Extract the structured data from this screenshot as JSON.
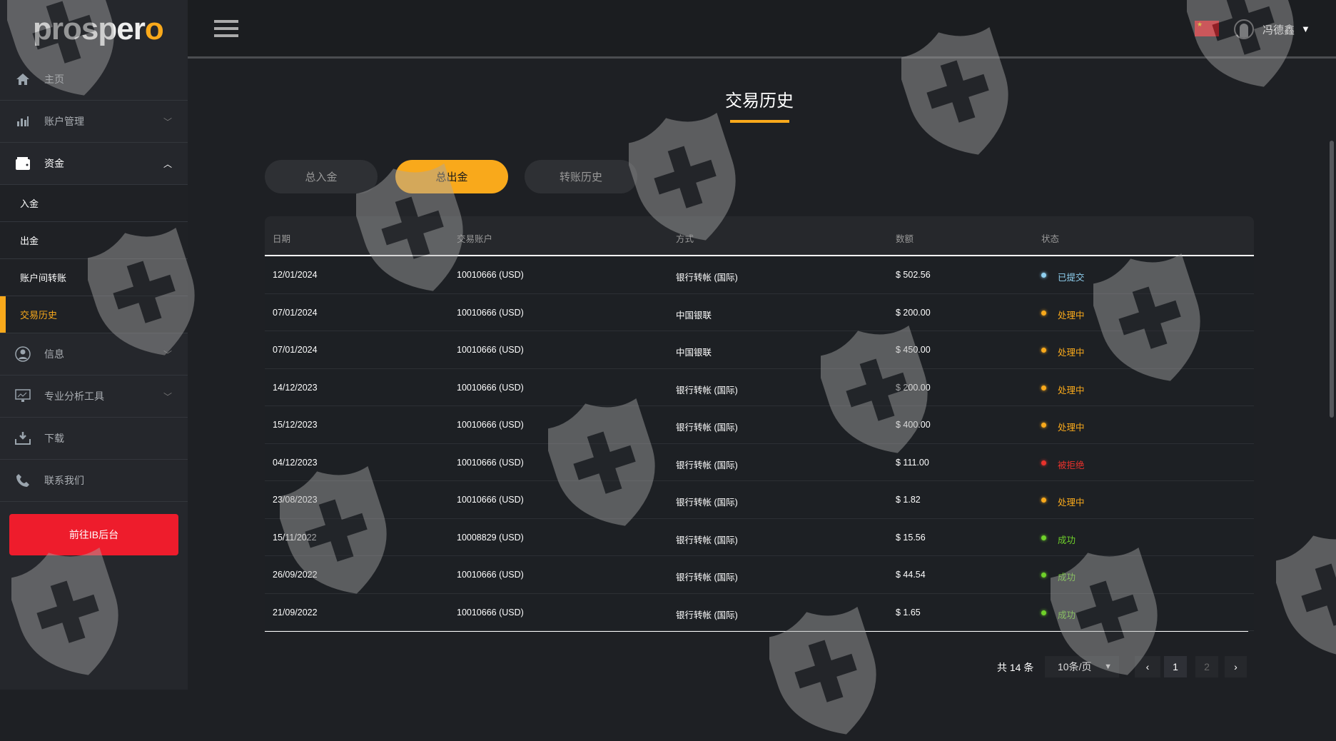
{
  "brand": {
    "logo_text": "prosper",
    "logo_accent": "o"
  },
  "sidebar": {
    "items": [
      {
        "label": "主页",
        "icon": "home-icon"
      },
      {
        "label": "账户管理",
        "icon": "bar-chart-icon"
      },
      {
        "label": "资金",
        "icon": "wallet-icon"
      }
    ],
    "sub_items": [
      {
        "label": "入金"
      },
      {
        "label": "出金"
      },
      {
        "label": "账户间转账"
      },
      {
        "label": "交易历史"
      }
    ],
    "items2": [
      {
        "label": "信息",
        "icon": "user-icon"
      },
      {
        "label": "专业分析工具",
        "icon": "monitor-chart-icon"
      },
      {
        "label": "下载",
        "icon": "download-icon"
      },
      {
        "label": "联系我们",
        "icon": "phone-icon"
      }
    ],
    "ib_button": "前往IB后台"
  },
  "header": {
    "user_name": "冯德鑫",
    "caret": "▼"
  },
  "page": {
    "title": "交易历史"
  },
  "tabs": [
    {
      "label": "总入金"
    },
    {
      "label": "总出金"
    },
    {
      "label": "转账历史"
    }
  ],
  "table": {
    "columns": [
      "日期",
      "交易账户",
      "方式",
      "数额",
      "状态"
    ],
    "rows": [
      {
        "date": "12/01/2024",
        "account": "10010666 (USD)",
        "method": "银行转帐 (国际)",
        "amount": "$ 502.56",
        "status": "已提交",
        "status_color": "#8fd0f0"
      },
      {
        "date": "07/01/2024",
        "account": "10010666 (USD)",
        "method": "中国银联",
        "amount": "$ 200.00",
        "status": "处理中",
        "status_color": "#f9a91b"
      },
      {
        "date": "07/01/2024",
        "account": "10010666 (USD)",
        "method": "中国银联",
        "amount": "$ 450.00",
        "status": "处理中",
        "status_color": "#f9a91b"
      },
      {
        "date": "14/12/2023",
        "account": "10010666 (USD)",
        "method": "银行转帐 (国际)",
        "amount": "$ 200.00",
        "status": "处理中",
        "status_color": "#f9a91b"
      },
      {
        "date": "15/12/2023",
        "account": "10010666 (USD)",
        "method": "银行转帐 (国际)",
        "amount": "$ 400.00",
        "status": "处理中",
        "status_color": "#f9a91b"
      },
      {
        "date": "04/12/2023",
        "account": "10010666 (USD)",
        "method": "银行转帐 (国际)",
        "amount": "$ 111.00",
        "status": "被拒绝",
        "status_color": "#e8322c"
      },
      {
        "date": "23/08/2023",
        "account": "10010666 (USD)",
        "method": "银行转帐 (国际)",
        "amount": "$ 1.82",
        "status": "处理中",
        "status_color": "#f9a91b"
      },
      {
        "date": "15/11/2022",
        "account": "10008829 (USD)",
        "method": "银行转帐 (国际)",
        "amount": "$ 15.56",
        "status": "成功",
        "status_color": "#6fd12a"
      },
      {
        "date": "26/09/2022",
        "account": "10010666 (USD)",
        "method": "银行转帐 (国际)",
        "amount": "$ 44.54",
        "status": "成功",
        "status_color": "#6fd12a"
      },
      {
        "date": "21/09/2022",
        "account": "10010666 (USD)",
        "method": "银行转帐 (国际)",
        "amount": "$ 1.65",
        "status": "成功",
        "status_color": "#6fd12a"
      }
    ]
  },
  "pagination": {
    "total": "共 14 条",
    "page_size": "10条/页",
    "prev": "‹",
    "next": "›",
    "pages": [
      "1",
      "2"
    ],
    "current": "1"
  }
}
